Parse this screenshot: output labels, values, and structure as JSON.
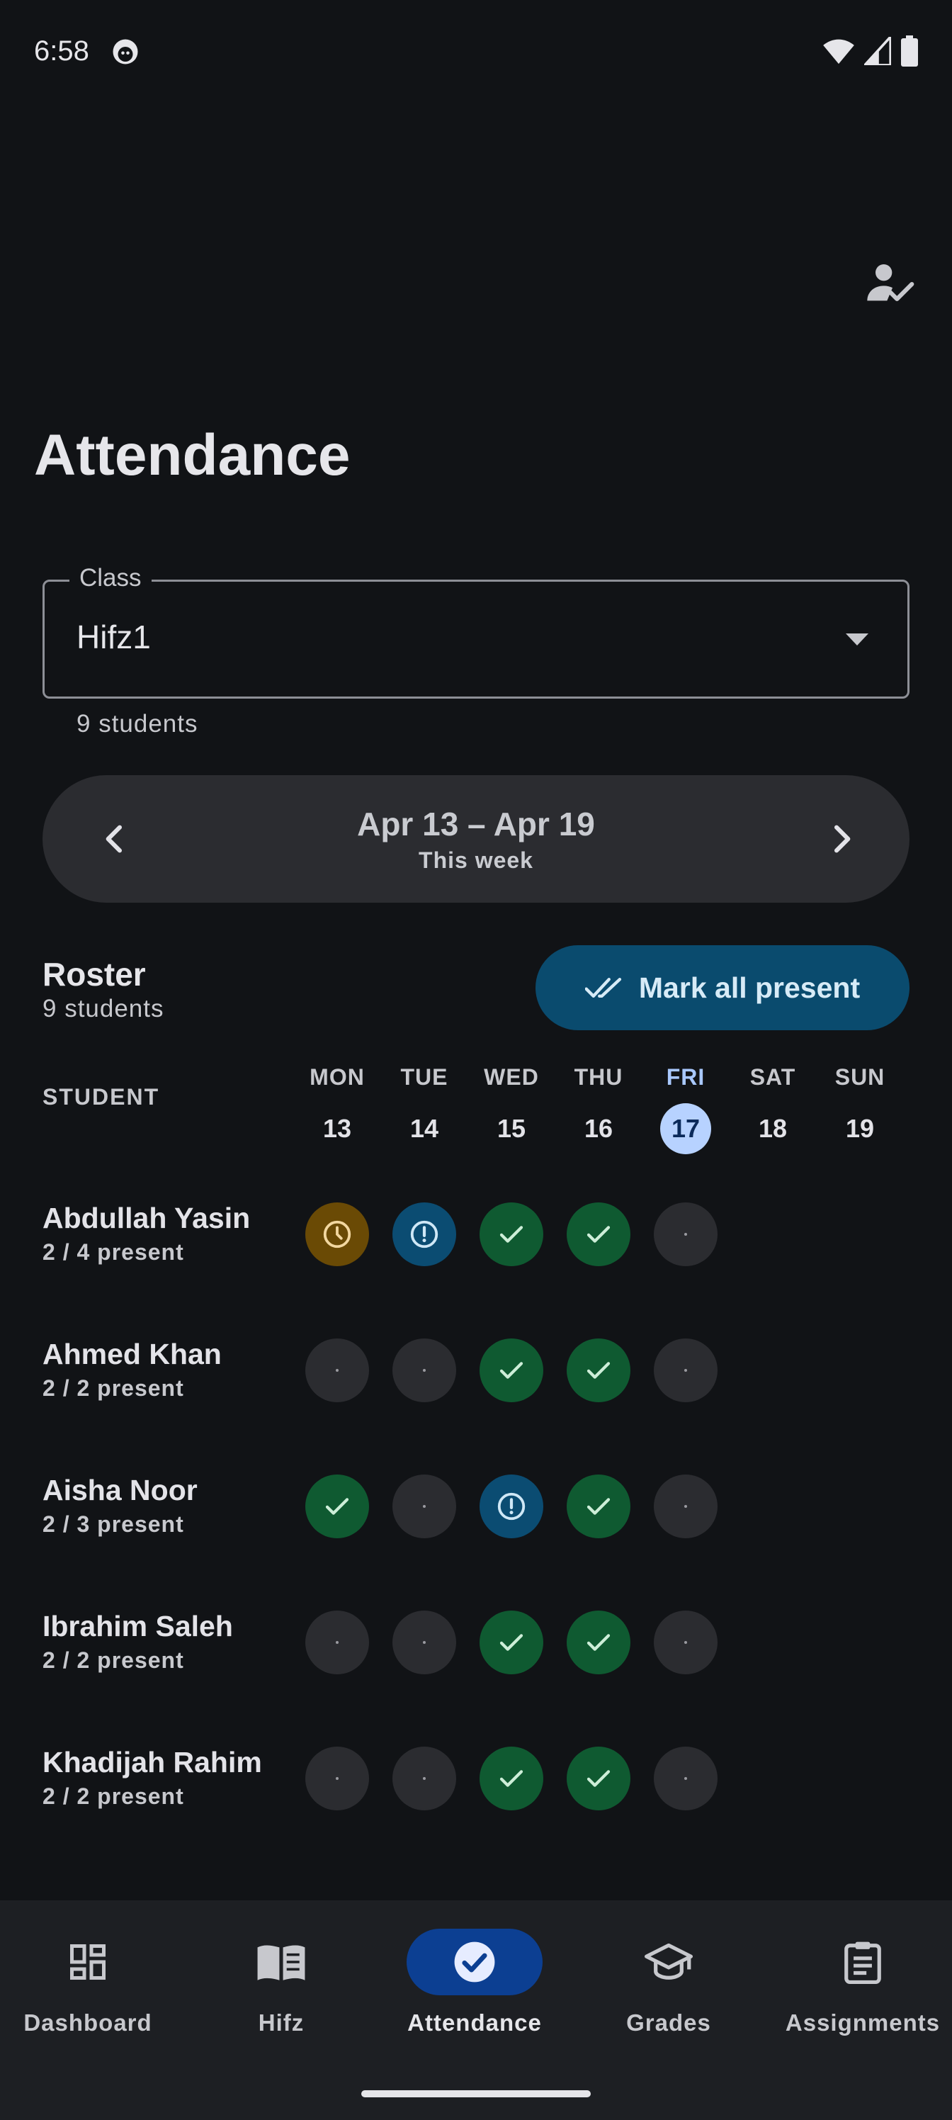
{
  "status_bar": {
    "time": "6:58"
  },
  "page": {
    "title": "Attendance"
  },
  "class_field": {
    "label": "Class",
    "value": "Hifz1",
    "helper": "9 students"
  },
  "week": {
    "range": "Apr 13 – Apr 19",
    "subtitle": "This week"
  },
  "roster": {
    "title": "Roster",
    "count": "9 students",
    "mark_all_label": "Mark all present",
    "student_header": "STUDENT",
    "days": [
      {
        "name": "MON",
        "num": "13"
      },
      {
        "name": "TUE",
        "num": "14"
      },
      {
        "name": "WED",
        "num": "15"
      },
      {
        "name": "THU",
        "num": "16"
      },
      {
        "name": "FRI",
        "num": "17"
      },
      {
        "name": "SAT",
        "num": "18"
      },
      {
        "name": "SUN",
        "num": "19"
      }
    ],
    "students": [
      {
        "name": "Abdullah Yasin",
        "summary": "2 / 4 present"
      },
      {
        "name": "Ahmed Khan",
        "summary": "2 / 2 present"
      },
      {
        "name": "Aisha Noor",
        "summary": "2 / 3 present"
      },
      {
        "name": "Ibrahim Saleh",
        "summary": "2 / 2 present"
      },
      {
        "name": "Khadijah Rahim",
        "summary": "2 / 2 present"
      }
    ]
  },
  "nav": {
    "items": [
      {
        "label": "Dashboard",
        "icon": "dashboard-icon"
      },
      {
        "label": "Hifz",
        "icon": "book-icon"
      },
      {
        "label": "Attendance",
        "icon": "check-circle-icon"
      },
      {
        "label": "Grades",
        "icon": "graduation-cap-icon"
      },
      {
        "label": "Assignments",
        "icon": "clipboard-icon"
      }
    ]
  }
}
